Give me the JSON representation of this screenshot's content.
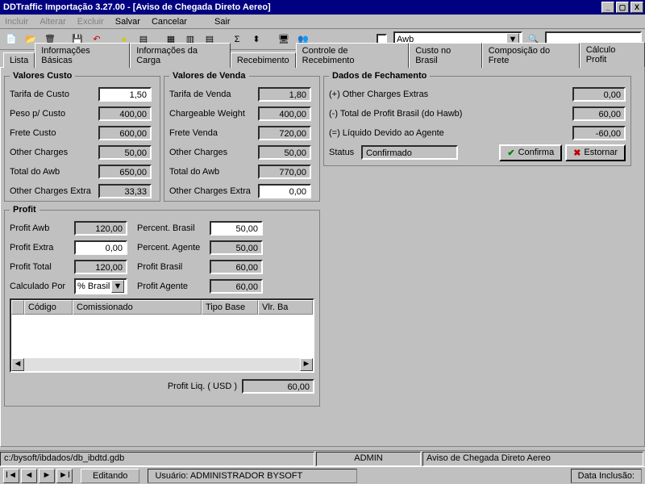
{
  "window": {
    "title": "DDTraffic Importação 3.27.00 - [Aviso de Chegada Direto Aereo]"
  },
  "menu": {
    "incluir": "Incluir",
    "alterar": "Alterar",
    "excluir": "Excluir",
    "salvar": "Salvar",
    "cancelar": "Cancelar",
    "sair": "Sair"
  },
  "toolbar_combo": {
    "label_prefix": "",
    "value": "Awb"
  },
  "tabs": {
    "items": [
      {
        "label": "Lista"
      },
      {
        "label": "Informações Básicas"
      },
      {
        "label": "Informações da Carga"
      },
      {
        "label": "Recebimento"
      },
      {
        "label": "Controle de Recebimento"
      },
      {
        "label": "Custo no Brasil"
      },
      {
        "label": "Composição do Frete"
      },
      {
        "label": "Cálculo Profit"
      }
    ],
    "active_index": 7
  },
  "custo": {
    "legend": "Valores Custo",
    "tarifa_label": "Tarifa de Custo",
    "tarifa_val": "1,50",
    "peso_label": "Peso p/ Custo",
    "peso_val": "400,00",
    "frete_label": "Frete Custo",
    "frete_val": "600,00",
    "other_label": "Other Charges",
    "other_val": "50,00",
    "total_label": "Total do Awb",
    "total_val": "650,00",
    "extra_label": "Other Charges Extra",
    "extra_val": "33,33"
  },
  "venda": {
    "legend": "Valores de Venda",
    "tarifa_label": "Tarifa de Venda",
    "tarifa_val": "1,80",
    "cw_label": "Chargeable Weight",
    "cw_val": "400,00",
    "frete_label": "Frete Venda",
    "frete_val": "720,00",
    "other_label": "Other Charges",
    "other_val": "50,00",
    "total_label": "Total do Awb",
    "total_val": "770,00",
    "extra_label": "Other Charges Extra",
    "extra_val": "0,00"
  },
  "fechamento": {
    "legend": "Dados de Fechamento",
    "line1_label": "(+) Other Charges Extras",
    "line1_val": "0,00",
    "line2_label": "(-) Total de Profit Brasil (do Hawb)",
    "line2_val": "60,00",
    "line3_label": "(=) Líquido Devido ao Agente",
    "line3_val": "-60,00",
    "status_label": "Status",
    "status_val": "Confirmado",
    "btn_confirma": "Confirma",
    "btn_estornar": "Estornar"
  },
  "profit": {
    "legend": "Profit",
    "awb_label": "Profit Awb",
    "awb_val": "120,00",
    "pbr_label": "Percent. Brasil",
    "pbr_val": "50,00",
    "extra_label": "Profit Extra",
    "extra_val": "0,00",
    "pag_label": "Percent. Agente",
    "pag_val": "50,00",
    "total_label": "Profit Total",
    "total_val": "120,00",
    "brasil_label": "Profit Brasil",
    "brasil_val": "60,00",
    "calc_label": "Calculado Por",
    "calc_val": "% Brasil",
    "agente_label": "Profit Agente",
    "agente_val": "60,00",
    "liq_label": "Profit Liq. ( USD )",
    "liq_val": "60,00"
  },
  "grid": {
    "cols": [
      "Código",
      "Comissionado",
      "Tipo Base",
      "Vlr. Ba"
    ]
  },
  "status": {
    "dbpath": "c:/bysoft/ibdados/db_ibdtd.gdb",
    "user": "ADMIN",
    "module": "Aviso de Chegada Direto Aereo"
  },
  "nav": {
    "mode": "Editando",
    "user_label": "Usuário: ADMINISTRADOR BYSOFT",
    "data_label": "Data Inclusão:"
  }
}
